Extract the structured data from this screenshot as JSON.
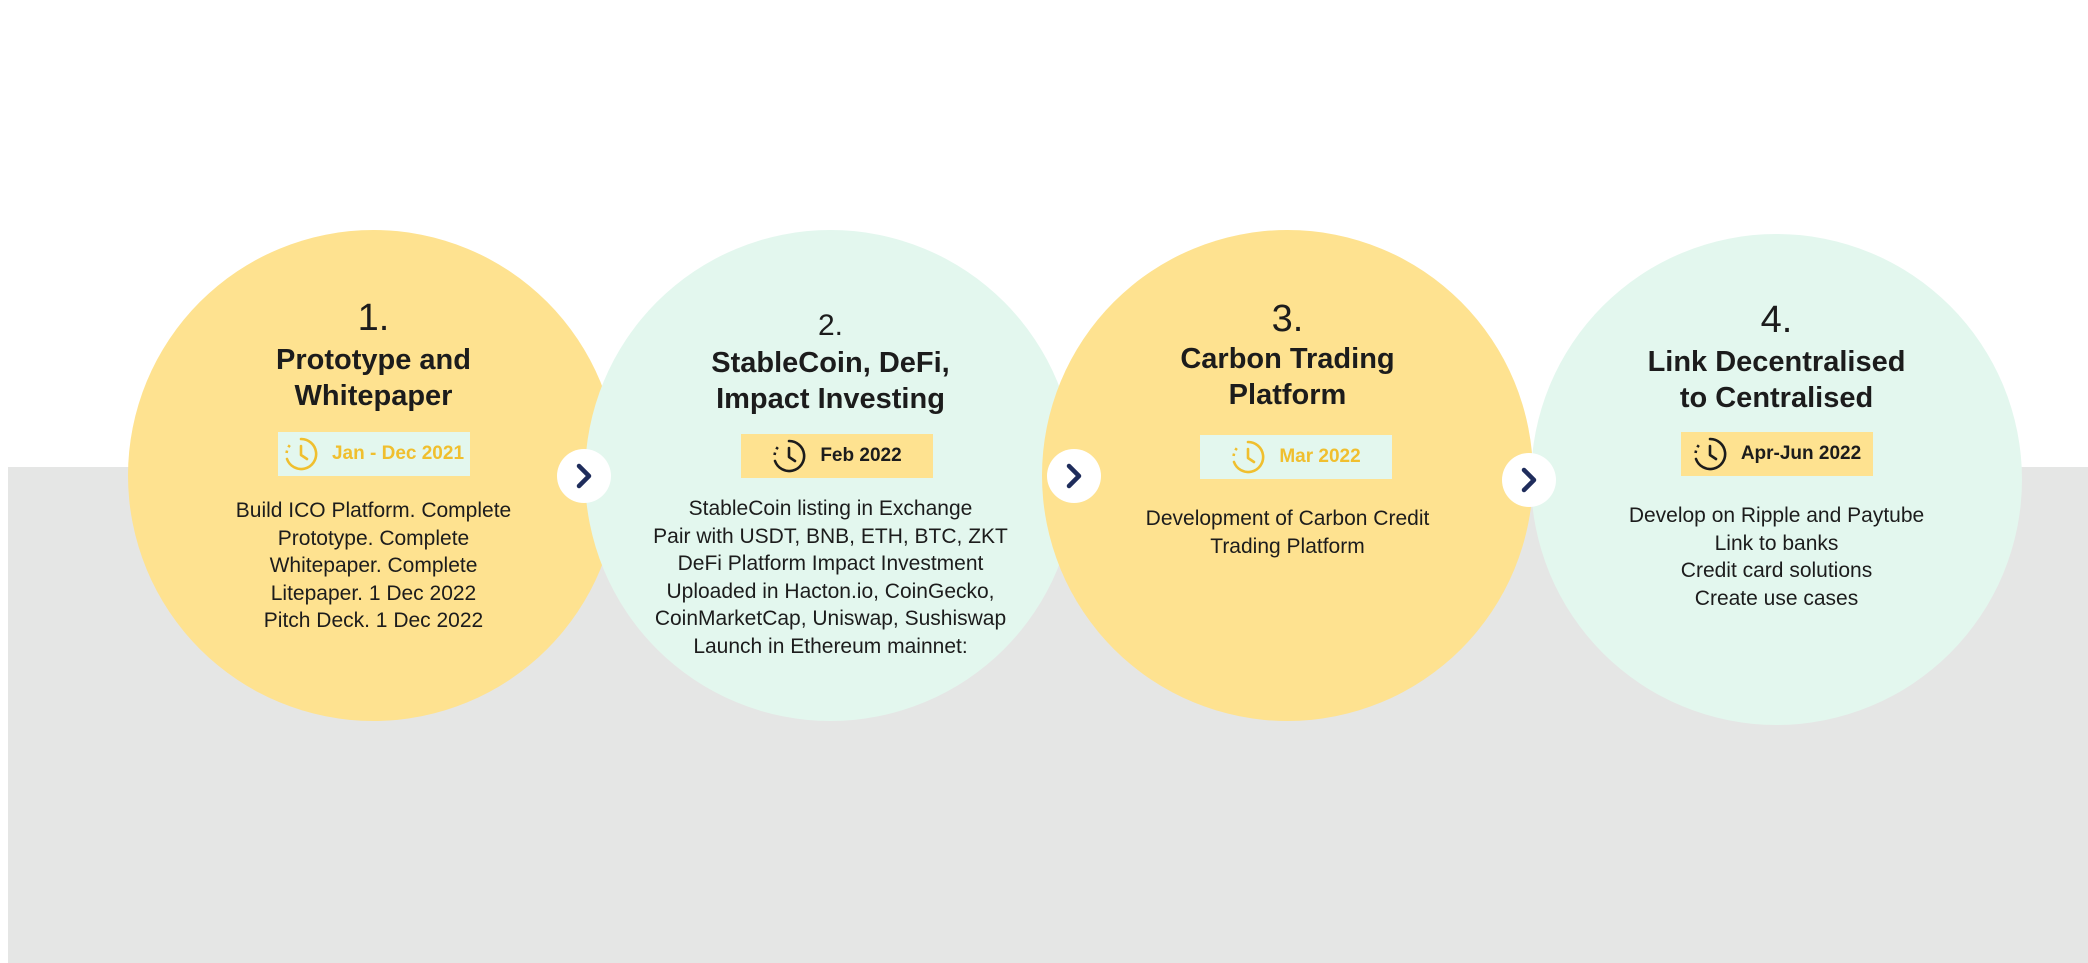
{
  "colors": {
    "yellow": "#fee290",
    "mint": "#e3f7ee",
    "gold_text": "#f0bf2e",
    "navy_arrow": "#1f2d5c",
    "gray_band": "#e5e6e5"
  },
  "steps": [
    {
      "number": "1.",
      "title_lines": [
        "Prototype and",
        "Whitepaper"
      ],
      "date": "Jan - Dec 2021",
      "icon": "clock-icon",
      "description_lines": [
        "Build ICO Platform. Complete",
        "Prototype. Complete",
        "Whitepaper. Complete",
        "Litepaper. 1 Dec 2022",
        "Pitch Deck. 1 Dec 2022"
      ]
    },
    {
      "number": "2.",
      "title_lines": [
        "StableCoin, DeFi,",
        "Impact Investing"
      ],
      "date": "Feb 2022",
      "icon": "clock-icon",
      "description_lines": [
        "StableCoin listing in Exchange",
        "Pair with USDT, BNB, ETH, BTC, ZKT",
        "DeFi Platform Impact Investment",
        "Uploaded in Hacton.io, CoinGecko,",
        "CoinMarketCap, Uniswap, Sushiswap",
        "Launch in Ethereum mainnet:"
      ]
    },
    {
      "number": "3.",
      "title_lines": [
        "Carbon Trading",
        "Platform"
      ],
      "date": "Mar 2022",
      "icon": "clock-icon",
      "description_lines": [
        "Development of Carbon Credit",
        "Trading Platform"
      ]
    },
    {
      "number": "4.",
      "title_lines": [
        "Link Decentralised",
        "to Centralised"
      ],
      "date": "Apr-Jun 2022",
      "icon": "clock-icon",
      "description_lines": [
        "Develop on Ripple and Paytube",
        "Link to banks",
        "Credit card solutions",
        "Create use cases"
      ]
    }
  ],
  "arrows": [
    {
      "icon": "chevron-right-icon"
    },
    {
      "icon": "chevron-right-icon"
    },
    {
      "icon": "chevron-right-icon"
    }
  ]
}
